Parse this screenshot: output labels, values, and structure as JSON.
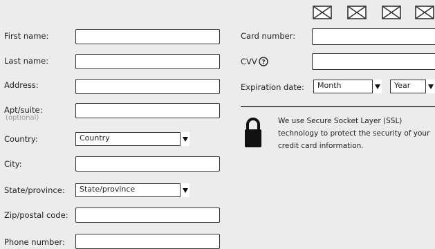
{
  "billing": {
    "first_name_label": "First name:",
    "last_name_label": "Last name:",
    "address_label": "Address:",
    "apt_label": "Apt/suite:",
    "apt_optional": "(optional)",
    "country_label": "Country:",
    "country_value": "Country",
    "city_label": "City:",
    "state_label": "State/province:",
    "state_value": "State/province",
    "zip_label": "Zip/postal code:",
    "phone_label": "Phone number:"
  },
  "payment": {
    "card_number_label": "Card number:",
    "cvv_label": "CVV",
    "expiration_label": "Expiration date:",
    "month_value": "Month",
    "year_value": "Year",
    "ssl_line1": "We use Secure Socket Layer (SSL)",
    "ssl_line2": "technology to protect the security of your",
    "ssl_line3": "credit card information."
  },
  "icons": {
    "card_images": [
      "image-placeholder-icon",
      "image-placeholder-icon",
      "image-placeholder-icon",
      "image-placeholder-icon"
    ],
    "help": "help-icon",
    "lock": "lock-icon"
  }
}
